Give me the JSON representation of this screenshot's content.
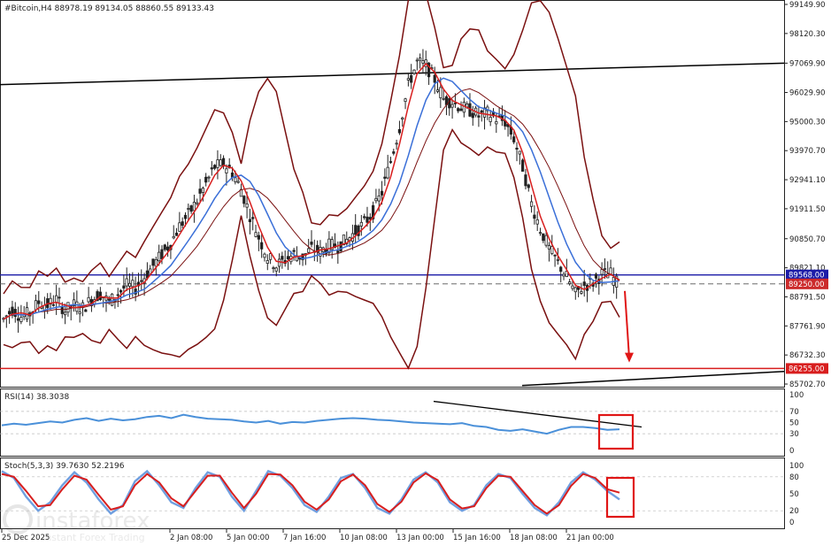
{
  "main_panel": {
    "header": "#Bitcoin,H4  88978.19 89134.05 88860.55 89133.43",
    "price_scale": [
      "99149.90",
      "98120.30",
      "97069.90",
      "96029.90",
      "95000.30",
      "93970.70",
      "92941.10",
      "91911.50",
      "90850.70",
      "89821.10",
      "88791.50",
      "87761.90",
      "86732.30",
      "85702.70"
    ],
    "price_tags": [
      {
        "value": "89568.00",
        "color": "#1c1ca8"
      },
      {
        "value": "89250.00",
        "color": "#cc2b2b"
      },
      {
        "value": "86255.00",
        "color": "#d81e1e"
      }
    ]
  },
  "rsi_panel": {
    "header": "RSI(14) 38.3038",
    "scale": [
      "100",
      "70",
      "50",
      "30",
      "0"
    ]
  },
  "stoch_panel": {
    "header": "Stoch(5,3,3) 39.7630 52.2196",
    "scale": [
      "100",
      "80",
      "50",
      "20",
      "0"
    ]
  },
  "time_axis": [
    "25 Dec 2025",
    "2 Jan 08:00",
    "5 Jan 00:00",
    "7 Jan 16:00",
    "10 Jan 08:00",
    "13 Jan 00:00",
    "15 Jan 16:00",
    "18 Jan 08:00",
    "21 Jan 00:00"
  ],
  "watermark": {
    "brand": "instaforex",
    "tagline": "Instant Forex Trading"
  },
  "colors": {
    "candles": "#222222",
    "bollinger": "#7a1010",
    "ma_fast": "#d81e1e",
    "ma_slow": "#3a6fd8",
    "rsi_line": "#4a90d9",
    "stoch_main": "#6f9fe0",
    "stoch_signal": "#d81e1e",
    "highlight": "#e01616"
  },
  "chart_data": [
    {
      "type": "line",
      "title": "#Bitcoin,H4",
      "ylim": [
        85702.7,
        99149.9
      ],
      "series": [
        {
          "values": [
            88000,
            88350,
            88100,
            88200,
            88600,
            88500,
            88700,
            88300,
            88500,
            88400,
            88700,
            88900,
            88600,
            88900,
            89200,
            89100,
            89500,
            89900,
            90300,
            90700,
            91300,
            91700,
            92200,
            92800,
            93400,
            93500,
            93200,
            92600,
            91700,
            90900,
            90200,
            89900,
            90100,
            90300,
            90200,
            90500,
            90400,
            90600,
            90600,
            90800,
            91100,
            91400,
            91800,
            92500,
            93600,
            94800,
            96300,
            97100,
            97000,
            96500,
            95800,
            95700,
            95500,
            95400,
            95200,
            95300,
            95100,
            95000,
            94400,
            93400,
            92100,
            91200,
            90500,
            90000,
            89500,
            88900,
            89200,
            89300,
            89600,
            89600,
            89133
          ]
        }
      ]
    },
    {
      "type": "line",
      "title": "RSI(14)",
      "ylim": [
        0,
        100
      ],
      "series": [
        {
          "values": [
            45,
            48,
            46,
            49,
            52,
            50,
            55,
            58,
            53,
            57,
            54,
            56,
            60,
            62,
            58,
            64,
            60,
            57,
            56,
            55,
            52,
            50,
            53,
            48,
            51,
            50,
            53,
            55,
            57,
            58,
            57,
            55,
            54,
            52,
            50,
            49,
            48,
            47,
            49,
            44,
            42,
            37,
            35,
            38,
            34,
            30,
            37,
            42,
            42,
            40,
            37,
            38
          ]
        }
      ]
    },
    {
      "type": "line",
      "title": "Stoch(5,3,3)",
      "ylim": [
        0,
        100
      ],
      "series": [
        {
          "values": [
            90,
            78,
            45,
            20,
            35,
            65,
            88,
            70,
            40,
            15,
            30,
            72,
            90,
            65,
            35,
            25,
            60,
            88,
            80,
            45,
            20,
            55,
            90,
            82,
            60,
            30,
            18,
            45,
            78,
            85,
            60,
            25,
            15,
            40,
            75,
            88,
            70,
            35,
            20,
            30,
            65,
            85,
            78,
            50,
            25,
            12,
            35,
            70,
            88,
            75,
            55,
            40
          ]
        },
        {
          "values": [
            85,
            80,
            55,
            28,
            30,
            58,
            82,
            75,
            48,
            22,
            28,
            65,
            85,
            70,
            42,
            28,
            55,
            82,
            82,
            52,
            25,
            50,
            85,
            84,
            65,
            36,
            22,
            40,
            72,
            84,
            65,
            32,
            18,
            36,
            70,
            86,
            74,
            40,
            24,
            28,
            60,
            82,
            80,
            55,
            30,
            15,
            30,
            64,
            85,
            78,
            58,
            52
          ]
        }
      ]
    }
  ]
}
